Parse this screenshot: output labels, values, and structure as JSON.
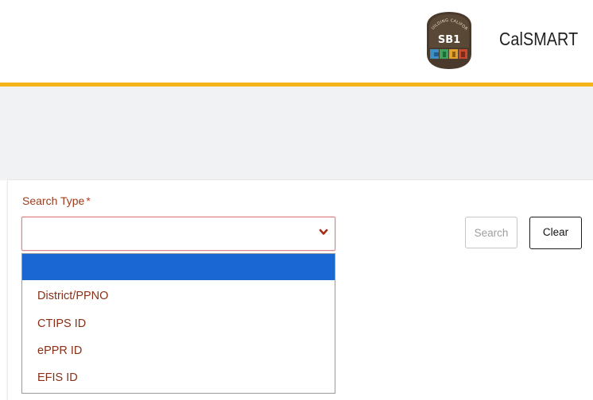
{
  "header": {
    "app_title": "CalSMART",
    "logo": {
      "text": "SB1",
      "arc_text": "REBUILDING CALIFORNIA"
    }
  },
  "colors": {
    "accent_bar": "#f4b21b",
    "banner_bg": "#f1f2f4",
    "label": "#9c3b1a",
    "option_text": "#8a2f16",
    "highlight": "#1a66d2"
  },
  "search_form": {
    "label": "Search Type",
    "required_mark": "*",
    "select_value": "",
    "options": [
      "",
      "District/PPNO",
      "CTIPS ID",
      "ePPR ID",
      "EFIS ID"
    ],
    "highlighted_index": 0,
    "search_label": "Search",
    "clear_label": "Clear"
  }
}
